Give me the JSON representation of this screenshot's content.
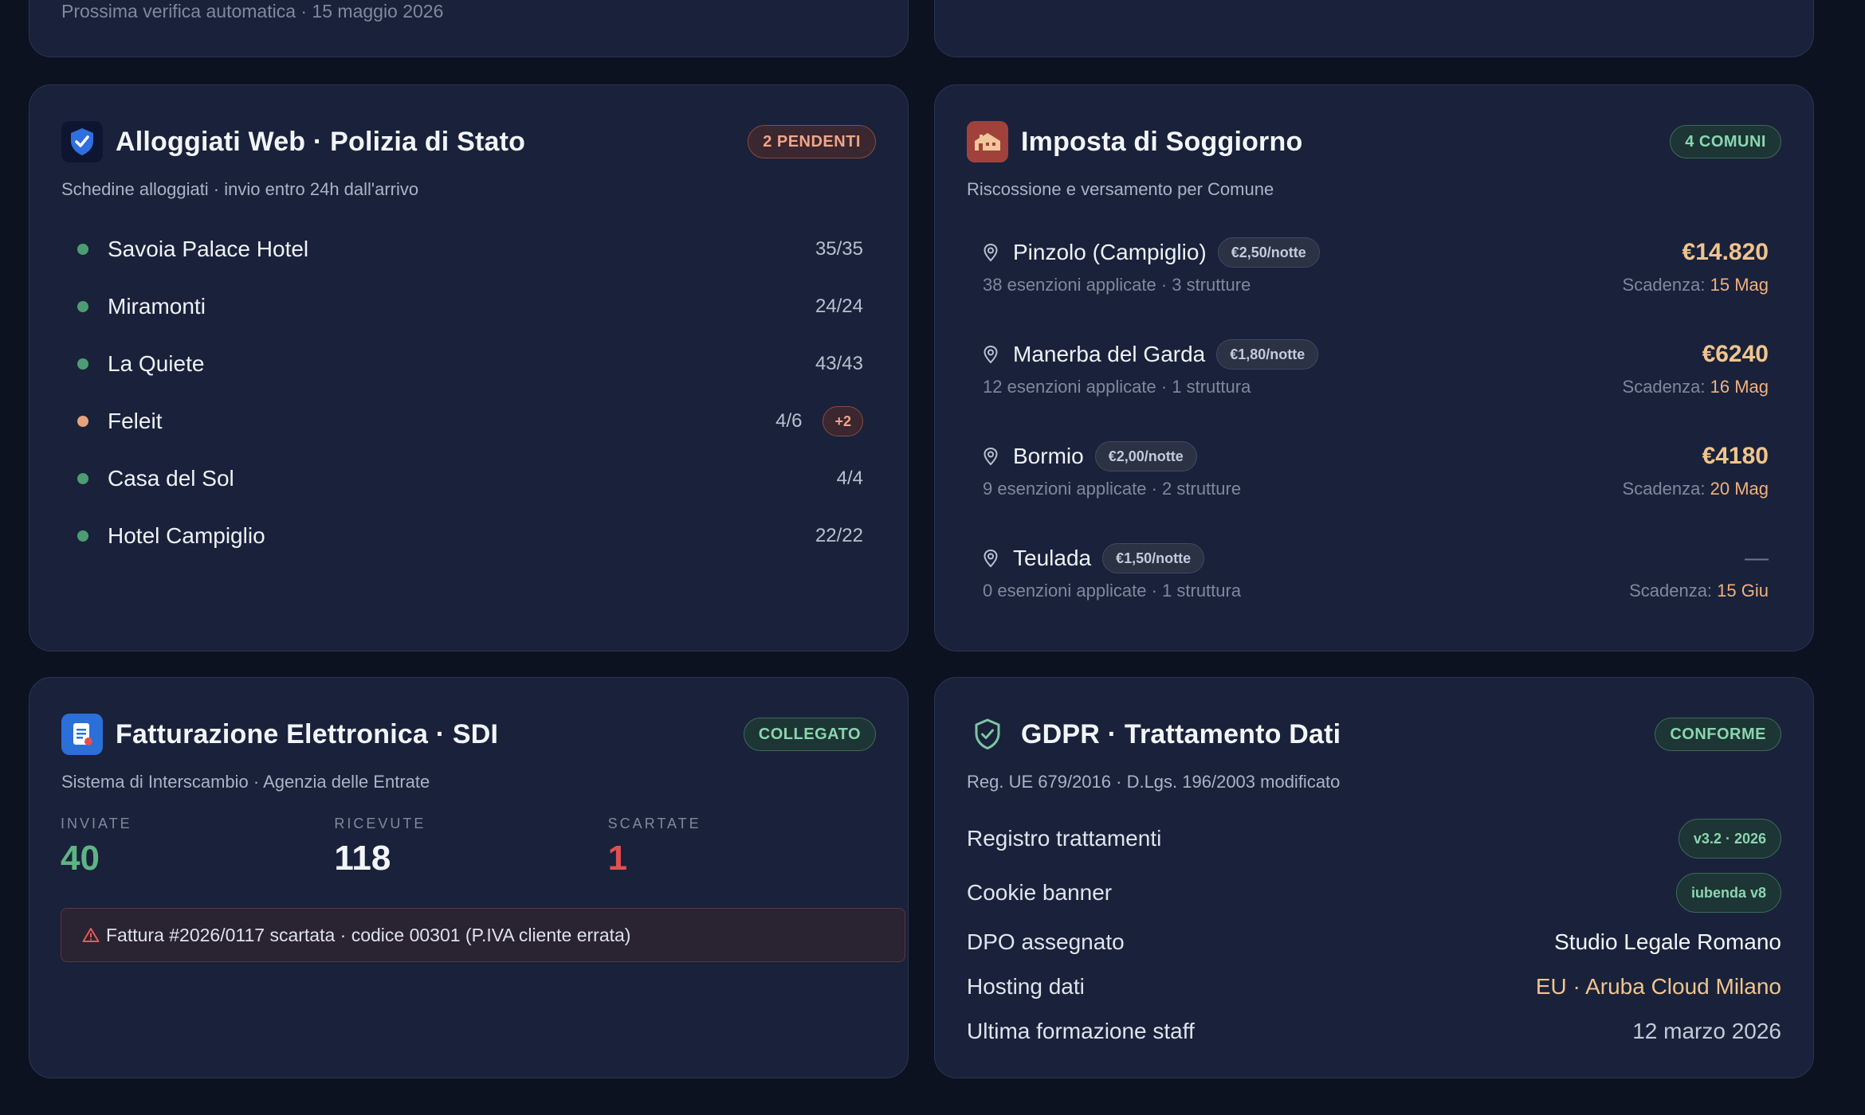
{
  "top_partial": {
    "next_check": "Prossima verifica automatica · 15 maggio 2026"
  },
  "colors": {
    "background": "#0c1220",
    "card": "#19223a",
    "ok": "#4d9d72",
    "warn": "#e8a37c",
    "amount": "#f0c48e",
    "error": "#e05050"
  },
  "alloggiati": {
    "icon": "shield-check-icon",
    "title": "Alloggiati Web · Polizia di Stato",
    "badge": "2 PENDENTI",
    "subtitle": "Schedine alloggiati · invio entro 24h dall'arrivo",
    "items": [
      {
        "name": "Savoia Palace Hotel",
        "count": "35/35",
        "status": "ok"
      },
      {
        "name": "Miramonti",
        "count": "24/24",
        "status": "ok"
      },
      {
        "name": "La Quiete",
        "count": "43/43",
        "status": "ok"
      },
      {
        "name": "Feleit",
        "count": "4/6",
        "status": "warn",
        "extra": "+2"
      },
      {
        "name": "Casa del Sol",
        "count": "4/4",
        "status": "ok"
      },
      {
        "name": "Hotel Campiglio",
        "count": "22/22",
        "status": "ok"
      }
    ]
  },
  "imposta": {
    "icon": "building-icon",
    "title": "Imposta di Soggiorno",
    "badge": "4 COMUNI",
    "subtitle": "Riscossione e versamento per Comune",
    "due_label": "Scadenza:",
    "items": [
      {
        "name": "Pinzolo (Campiglio)",
        "rate": "€2,50/notte",
        "amount": "€14.820",
        "detail": "38 esenzioni applicate · 3 strutture",
        "due": "15 Mag"
      },
      {
        "name": "Manerba del Garda",
        "rate": "€1,80/notte",
        "amount": "€6240",
        "detail": "12 esenzioni applicate · 1 struttura",
        "due": "16 Mag"
      },
      {
        "name": "Bormio",
        "rate": "€2,00/notte",
        "amount": "€4180",
        "detail": "9 esenzioni applicate · 2 strutture",
        "due": "20 Mag"
      },
      {
        "name": "Teulada",
        "rate": "€1,50/notte",
        "amount": "—",
        "detail": "0 esenzioni applicate · 1 struttura",
        "due": "15 Giu"
      }
    ]
  },
  "sdi": {
    "icon": "invoice-icon",
    "title": "Fatturazione Elettronica · SDI",
    "badge": "COLLEGATO",
    "subtitle": "Sistema di Interscambio · Agenzia delle Entrate",
    "stats": [
      {
        "label": "INVIATE",
        "value": "40",
        "color": "#5fb484"
      },
      {
        "label": "RICEVUTE",
        "value": "118",
        "color": "#f3f5fa"
      },
      {
        "label": "SCARTATE",
        "value": "1",
        "color": "#e05050"
      }
    ],
    "alert": "Fattura #2026/0117 scartata · codice 00301 (P.IVA cliente errata)"
  },
  "gdpr": {
    "icon": "shield-check-outline-icon",
    "title": "GDPR · Trattamento Dati",
    "badge": "CONFORME",
    "subtitle": "Reg. UE 679/2016 · D.Lgs. 196/2003 modificato",
    "rows": [
      {
        "label": "Registro trattamenti",
        "value": "v3.2 · 2026",
        "kind": "pill"
      },
      {
        "label": "Cookie banner",
        "value": "iubenda v8",
        "kind": "pill"
      },
      {
        "label": "DPO assegnato",
        "value": "Studio Legale Romano",
        "kind": "text",
        "color": "#f3f5fa"
      },
      {
        "label": "Hosting dati",
        "value": "EU · Aruba Cloud Milano",
        "kind": "text",
        "color": "#f0c48e"
      },
      {
        "label": "Ultima formazione staff",
        "value": "12 marzo 2026",
        "kind": "text",
        "color": "#c3cad8"
      }
    ]
  }
}
